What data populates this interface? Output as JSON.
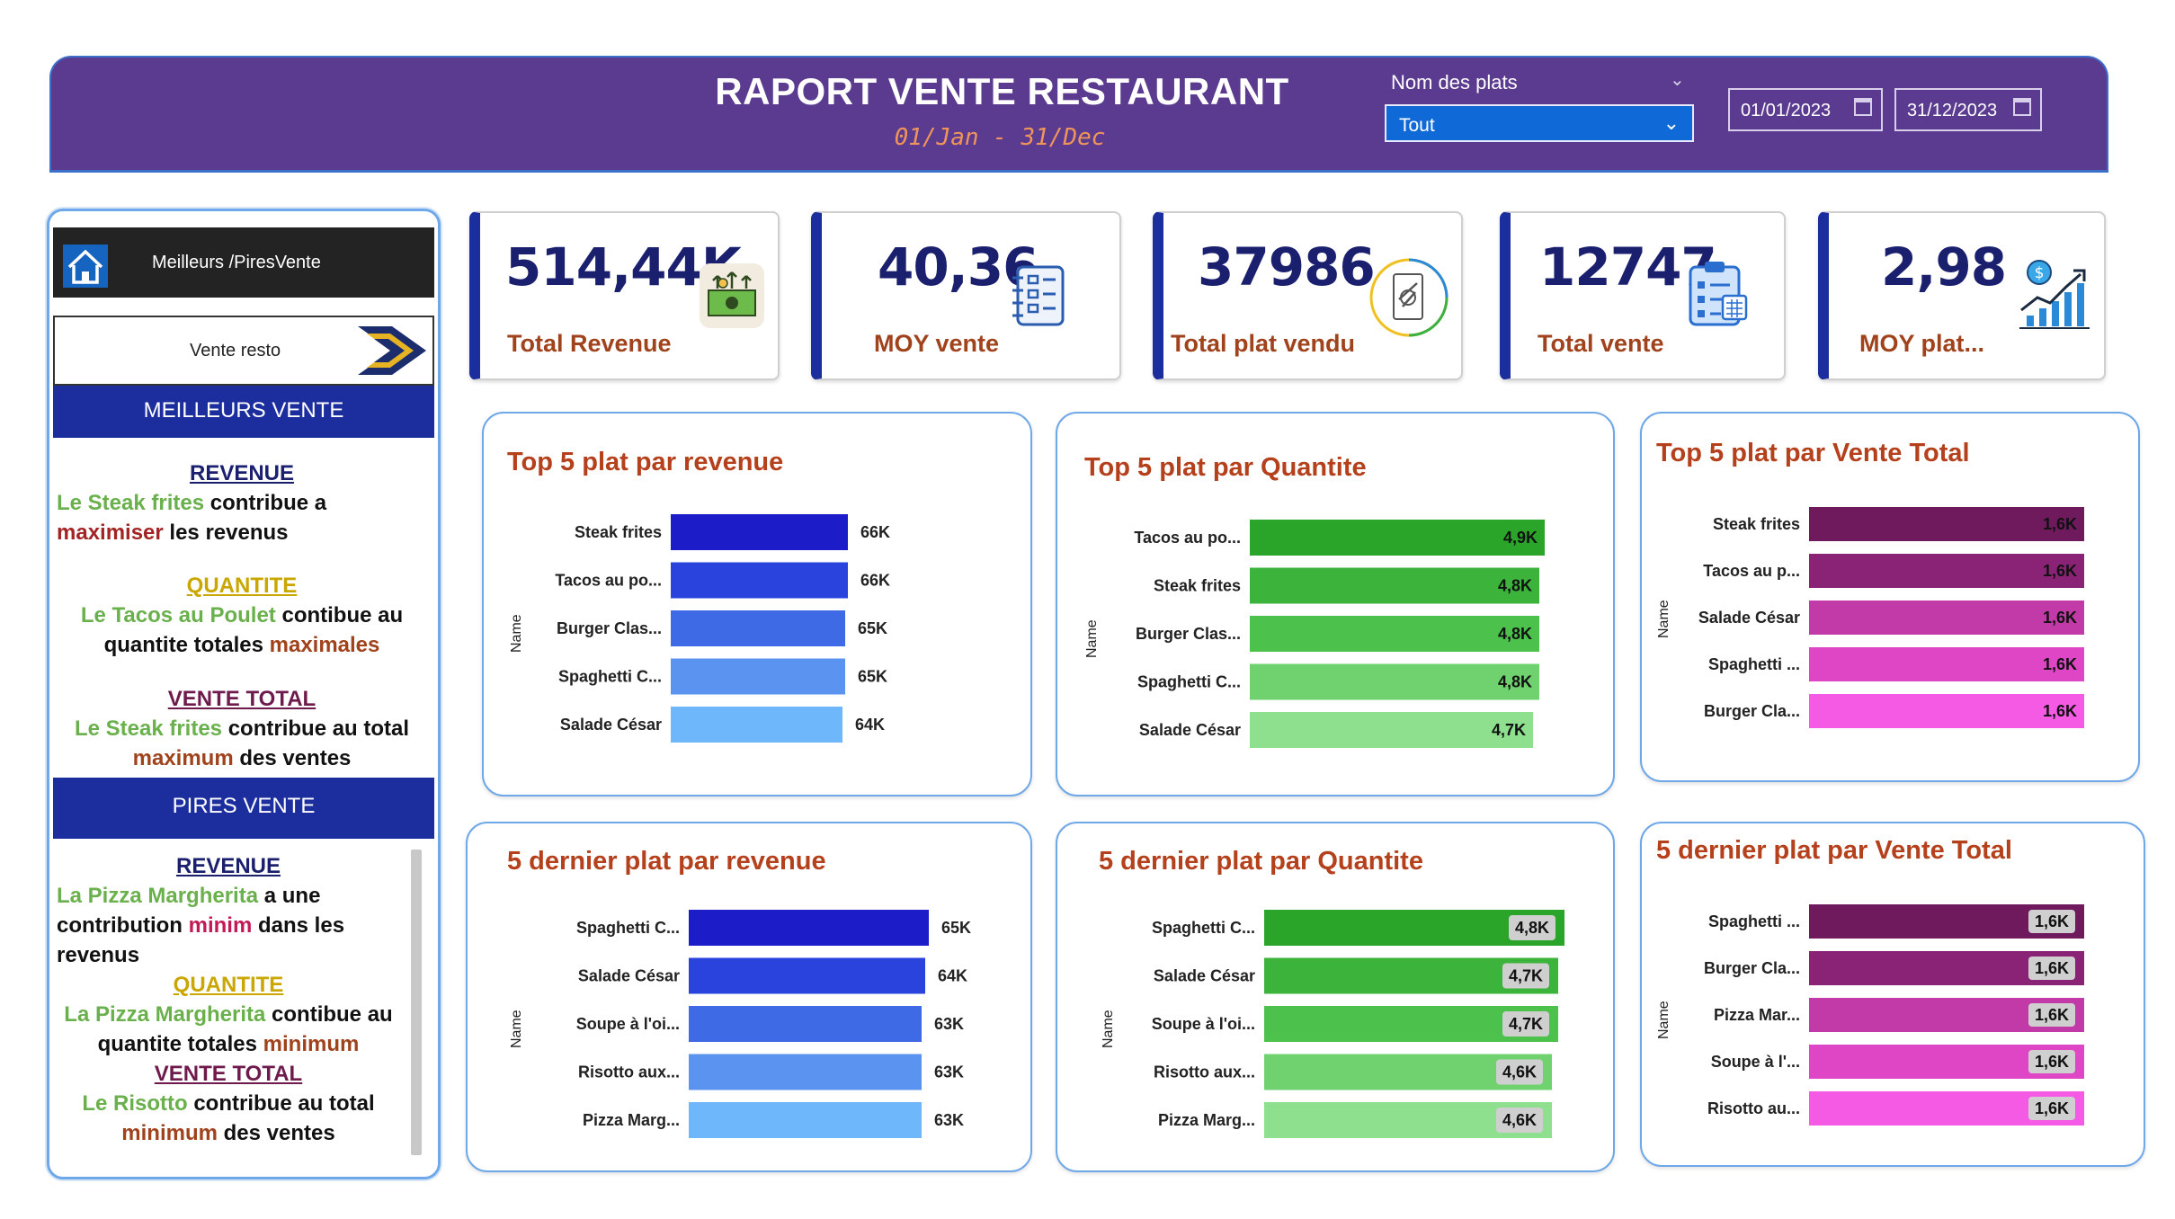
{
  "header": {
    "title": "RAPORT VENTE RESTAURANT",
    "subtitle": "01/Jan - 31/Dec",
    "filter_label": "Nom des plats",
    "filter_value": "Tout",
    "date_start": "01/01/2023",
    "date_end": "31/12/2023"
  },
  "sidebar": {
    "nav_dark_label": "Meilleurs /PiresVente",
    "nav_white_label": "Vente resto",
    "best_header": "MEILLEURS VENTE",
    "worst_header": "PIRES  VENTE",
    "best": {
      "revenue_title": "REVENUE",
      "revenue_a": "Le Steak frites",
      "revenue_b": " contribue a",
      "revenue_c": "maximiser",
      "revenue_d": " les revenus",
      "qty_title": "QUANTITE",
      "qty_a": "Le Tacos au Poulet",
      "qty_b": " contibue au",
      "qty_c": "quantite totales ",
      "qty_d": "maximales",
      "total_title": "VENTE TOTAL",
      "total_a": "Le Steak frites",
      "total_b": "  contribue au total",
      "total_c": "maximum",
      "total_d": " des ventes"
    },
    "worst": {
      "revenue_title": "REVENUE",
      "revenue_a": "La Pizza Margherita",
      "revenue_b": "  a une",
      "revenue_c": "contribution  ",
      "revenue_d": "minim",
      "revenue_e": " dans les",
      "revenue_f": "revenus",
      "qty_title": "QUANTITE",
      "qty_a": "La Pizza Margherita",
      "qty_b": " contibue au",
      "qty_c": "quantite totales ",
      "qty_d": "minimum",
      "total_title": "VENTE TOTAL",
      "total_a": "Le Risotto",
      "total_b": " contribue au total",
      "total_c": "minimum",
      "total_d": " des ventes"
    }
  },
  "kpis": [
    {
      "value": "514,44K",
      "label": "Total Revenue",
      "icon": "money-icon"
    },
    {
      "value": "40,36",
      "label": "MOY vente",
      "icon": "notepad-icon"
    },
    {
      "value": "37986",
      "label": "Total plat vendu",
      "icon": "dish-icon"
    },
    {
      "value": "12747",
      "label": "Total vente",
      "icon": "clipboard-icon"
    },
    {
      "value": "2,98",
      "label": "MOY plat...",
      "icon": "growth-chart-icon"
    }
  ],
  "colors": {
    "header_bg": "#5b3b8f",
    "navy": "#1c2d9e",
    "title_orange": "#b4401c",
    "blue_series": [
      "#1c1cc8",
      "#2a43dc",
      "#3f6ae6",
      "#5b93f0",
      "#6fb7fb"
    ],
    "green_series": [
      "#2aa52a",
      "#3cb43c",
      "#4cc24c",
      "#6fd26f",
      "#8ee08e"
    ],
    "pink_series": [
      "#6e1a5c",
      "#8a2276",
      "#c23aa8",
      "#de46c6",
      "#f45ae4"
    ]
  },
  "chart_data": [
    {
      "type": "bar",
      "title": "Top 5 plat par revenue",
      "ylabel": "Name",
      "categories": [
        "Steak frites",
        "Tacos au po...",
        "Burger Clas...",
        "Spaghetti C...",
        "Salade César"
      ],
      "values": [
        66,
        66,
        65,
        65,
        64
      ],
      "labels": [
        "66K",
        "66K",
        "65K",
        "65K",
        "64K"
      ],
      "palette": "blue_series",
      "label_pos": "outside",
      "max": 72
    },
    {
      "type": "bar",
      "title": "Top 5 plat par Quantite",
      "ylabel": "Name",
      "categories": [
        "Tacos au po...",
        "Steak frites",
        "Burger Clas...",
        "Spaghetti C...",
        "Salade César"
      ],
      "values": [
        4.9,
        4.8,
        4.8,
        4.8,
        4.7
      ],
      "labels": [
        "4,9K",
        "4,8K",
        "4,8K",
        "4,8K",
        "4,7K"
      ],
      "palette": "green_series",
      "label_pos": "inside",
      "max": 5.0
    },
    {
      "type": "bar",
      "title": "Top 5 plat par Vente Total",
      "ylabel": "Name",
      "categories": [
        "Steak frites",
        "Tacos au p...",
        "Salade César",
        "Spaghetti ...",
        "Burger Cla..."
      ],
      "values": [
        1.6,
        1.6,
        1.6,
        1.6,
        1.6
      ],
      "labels": [
        "1,6K",
        "1,6K",
        "1,6K",
        "1,6K",
        "1,6K"
      ],
      "palette": "pink_series",
      "label_pos": "inside",
      "max": 1.6
    },
    {
      "type": "bar",
      "title": "5 dernier plat par revenue",
      "ylabel": "Name",
      "categories": [
        "Spaghetti C...",
        "Salade César",
        "Soupe à l'oi...",
        "Risotto aux...",
        "Pizza Marg..."
      ],
      "values": [
        65,
        64,
        63,
        63,
        63
      ],
      "labels": [
        "65K",
        "64K",
        "63K",
        "63K",
        "63K"
      ],
      "palette": "blue_series",
      "label_pos": "outside",
      "max": 70.5
    },
    {
      "type": "bar",
      "title": "5 dernier plat par Quantite",
      "ylabel": "Name",
      "categories": [
        "Spaghetti C...",
        "Salade César",
        "Soupe à l'oi...",
        "Risotto aux...",
        "Pizza Marg..."
      ],
      "values": [
        4.8,
        4.7,
        4.7,
        4.6,
        4.6
      ],
      "labels": [
        "4,8K",
        "4,7K",
        "4,7K",
        "4,6K",
        "4,6K"
      ],
      "palette": "green_series",
      "label_pos": "boxed",
      "max": 4.8
    },
    {
      "type": "bar",
      "title": "5 dernier plat par Vente Total",
      "ylabel": "Name",
      "categories": [
        "Spaghetti ...",
        "Burger Cla...",
        "Pizza Mar...",
        "Soupe à l'...",
        "Risotto au..."
      ],
      "values": [
        1.6,
        1.6,
        1.6,
        1.6,
        1.6
      ],
      "labels": [
        "1,6K",
        "1,6K",
        "1,6K",
        "1,6K",
        "1,6K"
      ],
      "palette": "pink_series",
      "label_pos": "boxed",
      "max": 1.6
    }
  ]
}
